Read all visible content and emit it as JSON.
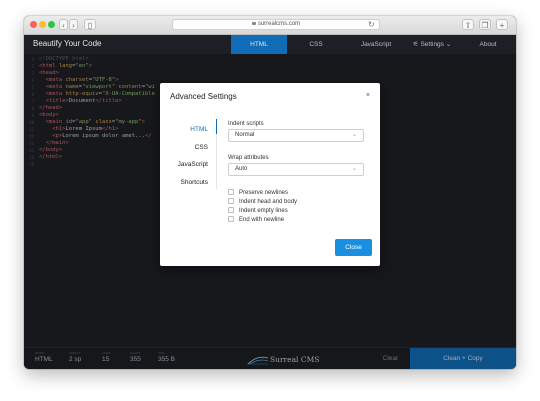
{
  "browser": {
    "url": "surrealcms.com"
  },
  "app": {
    "title": "Beautify Your Code",
    "nav": [
      {
        "label": "HTML",
        "active": true
      },
      {
        "label": "CSS",
        "active": false
      },
      {
        "label": "JavaScript",
        "active": false
      },
      {
        "label": "Settings",
        "active": false
      },
      {
        "label": "About",
        "active": false
      }
    ]
  },
  "editor": {
    "line_numbers": [
      "1",
      "2",
      "3",
      "4",
      "5",
      "6",
      "7",
      "8",
      "9",
      "10",
      "11",
      "12",
      "13",
      "14",
      "15",
      "16"
    ]
  },
  "modal": {
    "title": "Advanced Settings",
    "close_symbol": "×",
    "tabs": [
      "HTML",
      "CSS",
      "JavaScript",
      "Shortcuts"
    ],
    "indent_scripts_label": "Indent scripts",
    "indent_scripts_value": "Normal",
    "wrap_attributes_label": "Wrap attributes",
    "wrap_attributes_value": "Auto",
    "checkboxes": [
      "Preserve newlines",
      "Indent head and body",
      "Indent empty lines",
      "End with newline"
    ],
    "close_button": "Close"
  },
  "footer": {
    "mode": "HTML",
    "indent": "2 sp",
    "lines": "15",
    "chars": "355",
    "size": "355 B",
    "brand": "Surreal CMS",
    "clear": "Clear",
    "clean_copy": "Clean + Copy"
  },
  "colors": {
    "accent": "#106cb6",
    "button": "#1a8fe0",
    "background": "#1c1f24"
  }
}
